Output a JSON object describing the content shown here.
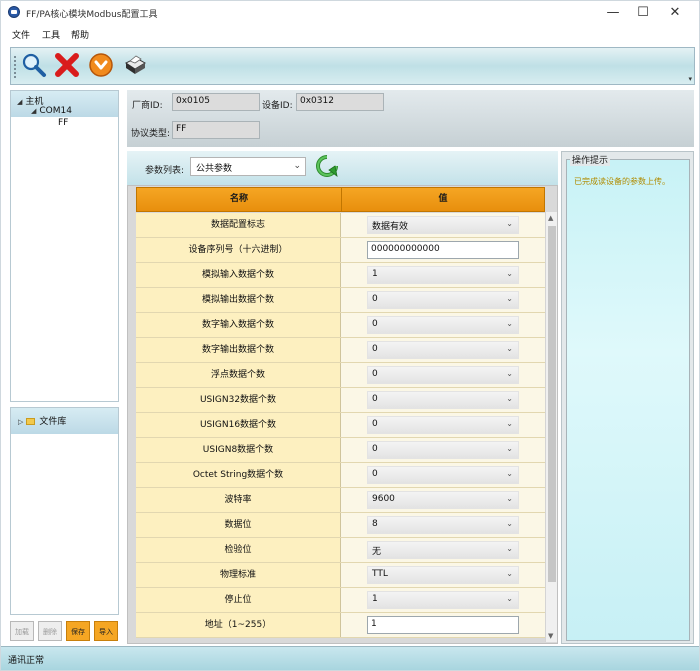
{
  "window": {
    "title": "FF/PA核心模块Modbus配置工具",
    "controls": [
      "—",
      "☐",
      "✕"
    ]
  },
  "menu": [
    "文件",
    "工具",
    "帮助"
  ],
  "toolbar": {
    "buttons": [
      {
        "icon": "search-icon"
      },
      {
        "icon": "delete-icon"
      },
      {
        "icon": "download-icon"
      },
      {
        "icon": "printer-icon"
      }
    ]
  },
  "tree": {
    "root": "主机",
    "port": "COM14",
    "device": "FF"
  },
  "library": {
    "label": "文件库"
  },
  "bottom_buttons": [
    "加载",
    "删除",
    "保存",
    "导入"
  ],
  "info": {
    "vendor_label": "厂商ID:",
    "vendor_value": "0x0105",
    "device_label": "设备ID:",
    "device_value": "0x0312",
    "protocol_label": "协议类型:",
    "protocol_value": "FF"
  },
  "params": {
    "list_label": "参数列表:",
    "list_value": "公共参数"
  },
  "grid": {
    "col_name": "名称",
    "col_value": "值",
    "rows": [
      {
        "name": "数据配置标志",
        "value": "数据有效",
        "type": "select"
      },
      {
        "name": "设备序列号（十六进制）",
        "value": "000000000000",
        "type": "input"
      },
      {
        "name": "模拟输入数据个数",
        "value": "1",
        "type": "select"
      },
      {
        "name": "模拟输出数据个数",
        "value": "0",
        "type": "select"
      },
      {
        "name": "数字输入数据个数",
        "value": "0",
        "type": "select"
      },
      {
        "name": "数字输出数据个数",
        "value": "0",
        "type": "select"
      },
      {
        "name": "浮点数据个数",
        "value": "0",
        "type": "select"
      },
      {
        "name": "USIGN32数据个数",
        "value": "0",
        "type": "select"
      },
      {
        "name": "USIGN16数据个数",
        "value": "0",
        "type": "select"
      },
      {
        "name": "USIGN8数据个数",
        "value": "0",
        "type": "select"
      },
      {
        "name": "Octet String数据个数",
        "value": "0",
        "type": "select"
      },
      {
        "name": "波特率",
        "value": "9600",
        "type": "select"
      },
      {
        "name": "数据位",
        "value": "8",
        "type": "select"
      },
      {
        "name": "检验位",
        "value": "无",
        "type": "select"
      },
      {
        "name": "物理标准",
        "value": "TTL",
        "type": "select"
      },
      {
        "name": "停止位",
        "value": "1",
        "type": "select"
      },
      {
        "name": "地址（1~255）",
        "value": "1",
        "type": "input"
      }
    ]
  },
  "hint": {
    "title": "操作提示",
    "text": "已完成读设备的参数上传。"
  },
  "status": {
    "text": "通讯正常"
  },
  "colors": {
    "header_orange": "#f5a623",
    "row_fill": "#fdf0c0",
    "hint_text": "#b08b00"
  }
}
